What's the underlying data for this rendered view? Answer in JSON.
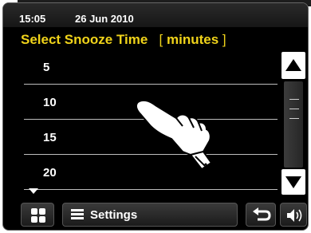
{
  "status": {
    "time": "15:05",
    "date": "26 Jun 2010"
  },
  "header": {
    "title": "Select Snooze Time",
    "unit": "minutes"
  },
  "list": {
    "items": [
      "5",
      "10",
      "15",
      "20"
    ]
  },
  "bottom": {
    "settings_label": "Settings"
  },
  "colors": {
    "title": "#f0d31a",
    "screen_bg": "#000000",
    "text": "#ffffff"
  }
}
